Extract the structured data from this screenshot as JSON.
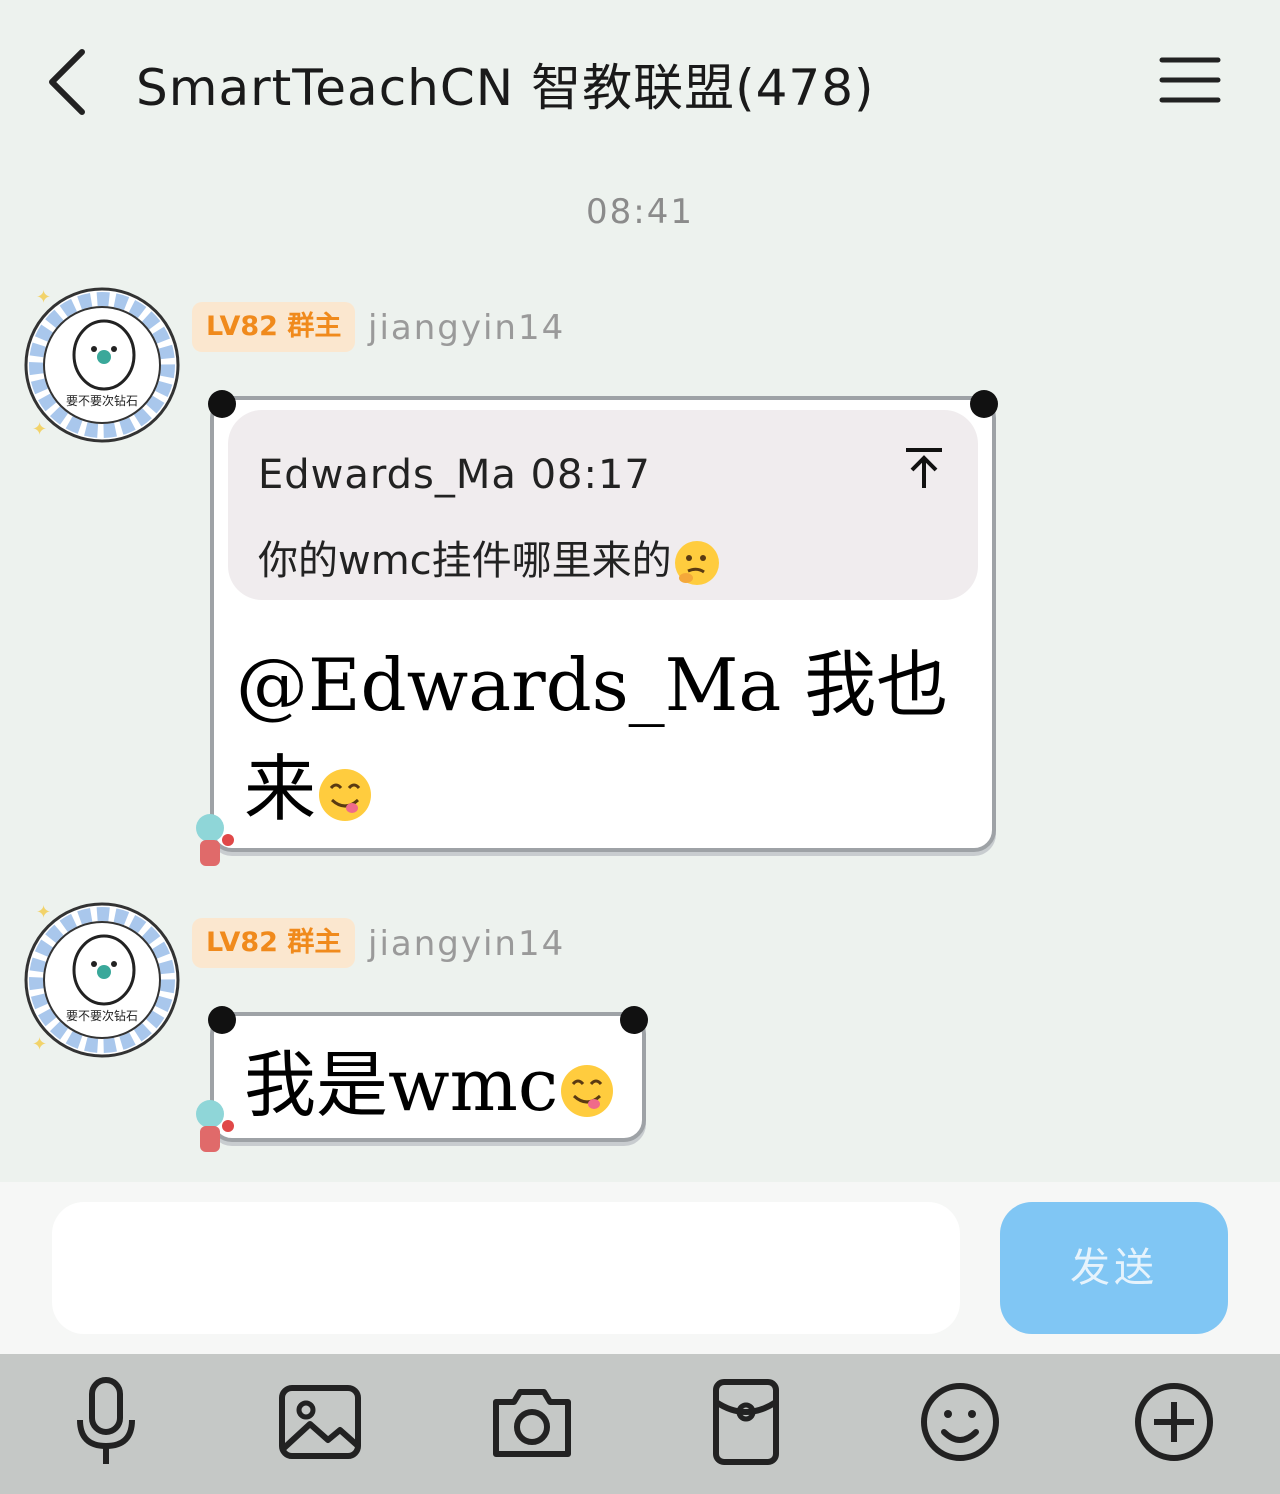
{
  "header": {
    "title": "SmartTeachCN 智教联盟(478)"
  },
  "timestamp": "08:41",
  "messages": [
    {
      "badge": "LV82 群主",
      "sender": "jiangyin14",
      "avatar_caption": "要不要次钻石",
      "quote": {
        "meta": "Edwards_Ma 08:17",
        "text": "你的wmc挂件哪里来的"
      },
      "text_line1": "@Edwards_Ma 我也",
      "text_line2": "来"
    },
    {
      "badge": "LV82 群主",
      "sender": "jiangyin14",
      "avatar_caption": "要不要次钻石",
      "text": "我是wmc"
    }
  ],
  "composer": {
    "send_label": "发送",
    "placeholder": ""
  },
  "toolbar": [
    "microphone-icon",
    "image-icon",
    "camera-icon",
    "red-packet-icon",
    "emoji-icon",
    "plus-icon"
  ],
  "colors": {
    "send_button": "#80c6f4",
    "badge_text": "#f08a1c",
    "background": "#edf2ee"
  }
}
